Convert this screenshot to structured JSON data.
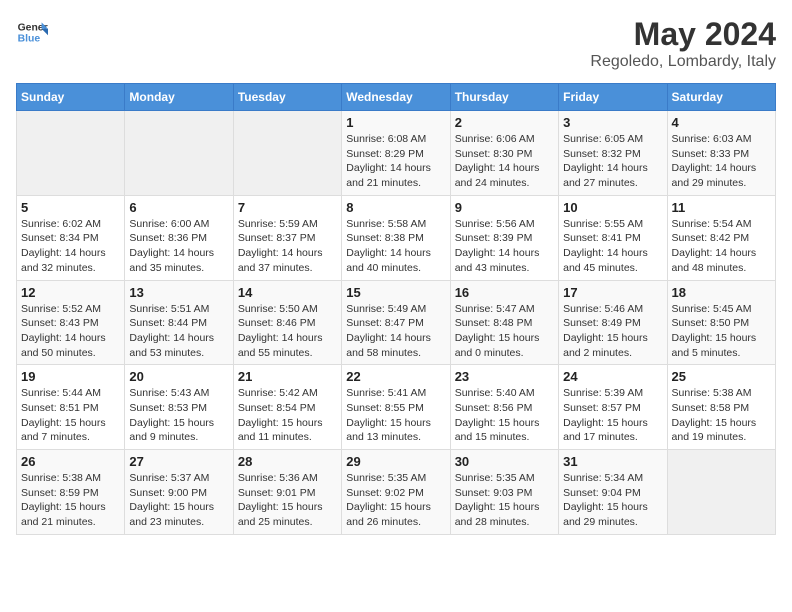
{
  "header": {
    "logo_line1": "General",
    "logo_line2": "Blue",
    "title": "May 2024",
    "subtitle": "Regoledo, Lombardy, Italy"
  },
  "weekdays": [
    "Sunday",
    "Monday",
    "Tuesday",
    "Wednesday",
    "Thursday",
    "Friday",
    "Saturday"
  ],
  "weeks": [
    [
      {
        "day": "",
        "info": ""
      },
      {
        "day": "",
        "info": ""
      },
      {
        "day": "",
        "info": ""
      },
      {
        "day": "1",
        "info": "Sunrise: 6:08 AM\nSunset: 8:29 PM\nDaylight: 14 hours\nand 21 minutes."
      },
      {
        "day": "2",
        "info": "Sunrise: 6:06 AM\nSunset: 8:30 PM\nDaylight: 14 hours\nand 24 minutes."
      },
      {
        "day": "3",
        "info": "Sunrise: 6:05 AM\nSunset: 8:32 PM\nDaylight: 14 hours\nand 27 minutes."
      },
      {
        "day": "4",
        "info": "Sunrise: 6:03 AM\nSunset: 8:33 PM\nDaylight: 14 hours\nand 29 minutes."
      }
    ],
    [
      {
        "day": "5",
        "info": "Sunrise: 6:02 AM\nSunset: 8:34 PM\nDaylight: 14 hours\nand 32 minutes."
      },
      {
        "day": "6",
        "info": "Sunrise: 6:00 AM\nSunset: 8:36 PM\nDaylight: 14 hours\nand 35 minutes."
      },
      {
        "day": "7",
        "info": "Sunrise: 5:59 AM\nSunset: 8:37 PM\nDaylight: 14 hours\nand 37 minutes."
      },
      {
        "day": "8",
        "info": "Sunrise: 5:58 AM\nSunset: 8:38 PM\nDaylight: 14 hours\nand 40 minutes."
      },
      {
        "day": "9",
        "info": "Sunrise: 5:56 AM\nSunset: 8:39 PM\nDaylight: 14 hours\nand 43 minutes."
      },
      {
        "day": "10",
        "info": "Sunrise: 5:55 AM\nSunset: 8:41 PM\nDaylight: 14 hours\nand 45 minutes."
      },
      {
        "day": "11",
        "info": "Sunrise: 5:54 AM\nSunset: 8:42 PM\nDaylight: 14 hours\nand 48 minutes."
      }
    ],
    [
      {
        "day": "12",
        "info": "Sunrise: 5:52 AM\nSunset: 8:43 PM\nDaylight: 14 hours\nand 50 minutes."
      },
      {
        "day": "13",
        "info": "Sunrise: 5:51 AM\nSunset: 8:44 PM\nDaylight: 14 hours\nand 53 minutes."
      },
      {
        "day": "14",
        "info": "Sunrise: 5:50 AM\nSunset: 8:46 PM\nDaylight: 14 hours\nand 55 minutes."
      },
      {
        "day": "15",
        "info": "Sunrise: 5:49 AM\nSunset: 8:47 PM\nDaylight: 14 hours\nand 58 minutes."
      },
      {
        "day": "16",
        "info": "Sunrise: 5:47 AM\nSunset: 8:48 PM\nDaylight: 15 hours\nand 0 minutes."
      },
      {
        "day": "17",
        "info": "Sunrise: 5:46 AM\nSunset: 8:49 PM\nDaylight: 15 hours\nand 2 minutes."
      },
      {
        "day": "18",
        "info": "Sunrise: 5:45 AM\nSunset: 8:50 PM\nDaylight: 15 hours\nand 5 minutes."
      }
    ],
    [
      {
        "day": "19",
        "info": "Sunrise: 5:44 AM\nSunset: 8:51 PM\nDaylight: 15 hours\nand 7 minutes."
      },
      {
        "day": "20",
        "info": "Sunrise: 5:43 AM\nSunset: 8:53 PM\nDaylight: 15 hours\nand 9 minutes."
      },
      {
        "day": "21",
        "info": "Sunrise: 5:42 AM\nSunset: 8:54 PM\nDaylight: 15 hours\nand 11 minutes."
      },
      {
        "day": "22",
        "info": "Sunrise: 5:41 AM\nSunset: 8:55 PM\nDaylight: 15 hours\nand 13 minutes."
      },
      {
        "day": "23",
        "info": "Sunrise: 5:40 AM\nSunset: 8:56 PM\nDaylight: 15 hours\nand 15 minutes."
      },
      {
        "day": "24",
        "info": "Sunrise: 5:39 AM\nSunset: 8:57 PM\nDaylight: 15 hours\nand 17 minutes."
      },
      {
        "day": "25",
        "info": "Sunrise: 5:38 AM\nSunset: 8:58 PM\nDaylight: 15 hours\nand 19 minutes."
      }
    ],
    [
      {
        "day": "26",
        "info": "Sunrise: 5:38 AM\nSunset: 8:59 PM\nDaylight: 15 hours\nand 21 minutes."
      },
      {
        "day": "27",
        "info": "Sunrise: 5:37 AM\nSunset: 9:00 PM\nDaylight: 15 hours\nand 23 minutes."
      },
      {
        "day": "28",
        "info": "Sunrise: 5:36 AM\nSunset: 9:01 PM\nDaylight: 15 hours\nand 25 minutes."
      },
      {
        "day": "29",
        "info": "Sunrise: 5:35 AM\nSunset: 9:02 PM\nDaylight: 15 hours\nand 26 minutes."
      },
      {
        "day": "30",
        "info": "Sunrise: 5:35 AM\nSunset: 9:03 PM\nDaylight: 15 hours\nand 28 minutes."
      },
      {
        "day": "31",
        "info": "Sunrise: 5:34 AM\nSunset: 9:04 PM\nDaylight: 15 hours\nand 29 minutes."
      },
      {
        "day": "",
        "info": ""
      }
    ]
  ]
}
